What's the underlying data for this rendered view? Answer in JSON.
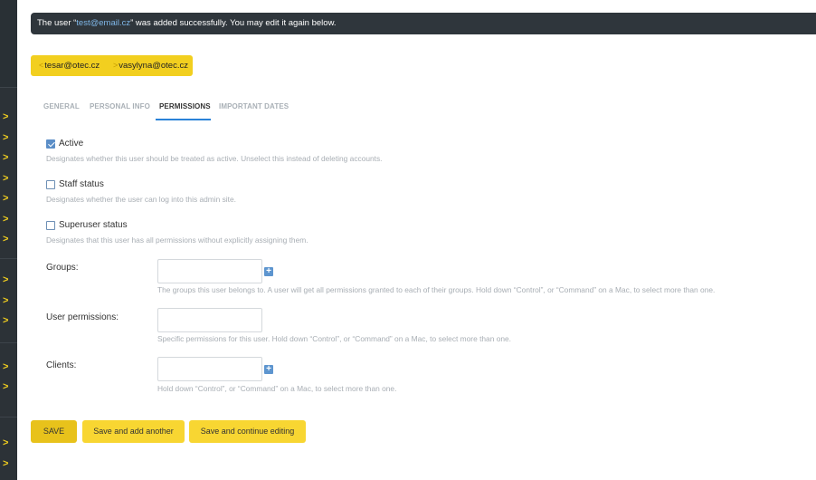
{
  "message": {
    "prefix": "The user “",
    "email": "test@email.cz",
    "suffix": "” was added successfully. You may edit it again below."
  },
  "object_nav": {
    "prev_arrow": "<",
    "prev": "tesar@otec.cz",
    "next_arrow": ">",
    "next": "vasylyna@otec.cz"
  },
  "tabs": [
    "GENERAL",
    "PERSONAL INFO",
    "PERMISSIONS",
    "IMPORTANT DATES"
  ],
  "active_tab": "PERMISSIONS",
  "permissions": {
    "active": {
      "label": "Active",
      "checked": true,
      "help": "Designates whether this user should be treated as active. Unselect this instead of deleting accounts."
    },
    "staff": {
      "label": "Staff status",
      "checked": false,
      "help": "Designates whether the user can log into this admin site."
    },
    "superuser": {
      "label": "Superuser status",
      "checked": false,
      "help": "Designates that this user has all permissions without explicitly assigning them."
    }
  },
  "groups": {
    "label": "Groups:",
    "add_icon": "+",
    "help": "The groups this user belongs to. A user will get all permissions granted to each of their groups. Hold down “Control”, or “Command” on a Mac, to select more than one."
  },
  "user_permissions": {
    "label": "User permissions:",
    "help": "Specific permissions for this user. Hold down “Control”, or “Command” on a Mac, to select more than one."
  },
  "clients": {
    "label": "Clients:",
    "add_icon": "+",
    "help": "Hold down “Control”, or “Command” on a Mac, to select more than one."
  },
  "buttons": {
    "save": "SAVE",
    "add_another": "Save and add another",
    "continue": "Save and continue editing"
  },
  "sidebar": {
    "chevron": ">"
  },
  "colors": {
    "accent_yellow": "#f2cf1f",
    "sidebar_dark": "#2c3237",
    "tab_active_underline": "#2a82d8",
    "checkbox_blue": "#5b8ec7"
  }
}
